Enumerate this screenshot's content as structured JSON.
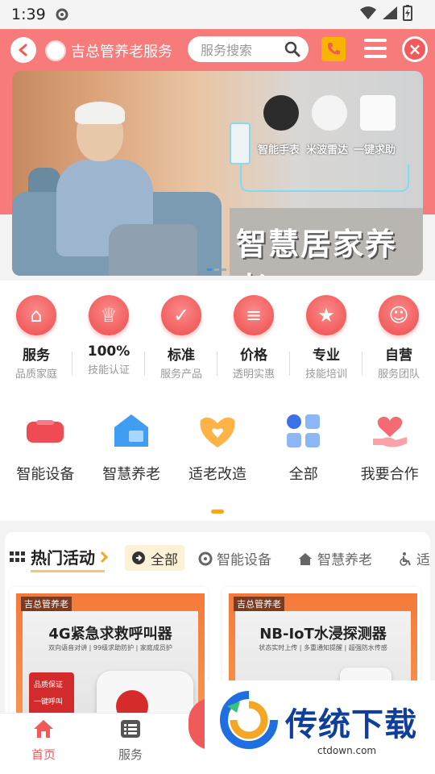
{
  "status_bar": {
    "time": "1:39"
  },
  "header": {
    "title": "吉总管养老服务",
    "search_placeholder": "服务搜索"
  },
  "banner": {
    "headline": "智慧居家养老",
    "devices": [
      "智能手表",
      "米波雷达",
      "一键求助"
    ],
    "active_slide": 1,
    "slide_count": 3
  },
  "features": [
    {
      "main": "服务",
      "sub": "品质家庭",
      "icon": "house-icon"
    },
    {
      "main": "100%",
      "sub": "技能认证",
      "icon": "crown-icon"
    },
    {
      "main": "标准",
      "sub": "服务产品",
      "icon": "clipboard-icon"
    },
    {
      "main": "价格",
      "sub": "透明实惠",
      "icon": "coins-icon"
    },
    {
      "main": "专业",
      "sub": "技能培训",
      "icon": "medal-icon"
    },
    {
      "main": "自营",
      "sub": "服务团队",
      "icon": "staff-icon"
    }
  ],
  "categories": [
    {
      "label": "智能设备",
      "icon": "device-icon"
    },
    {
      "label": "智慧养老",
      "icon": "smart-home-icon"
    },
    {
      "label": "适老改造",
      "icon": "heart-hands-icon"
    },
    {
      "label": "全部",
      "icon": "grid-icon"
    },
    {
      "label": "我要合作",
      "icon": "cooperation-icon"
    }
  ],
  "activities": {
    "title": "热门活动",
    "tabs": [
      "全部",
      "智能设备",
      "智慧养老",
      "适"
    ],
    "cards": [
      {
        "brand": "吉总管养老",
        "title": "4G紧急求救呼叫器",
        "subtitle": "双向语音对讲 | 99级求助防护 | 家庭成员护",
        "badges": [
          "品质保证",
          "一键呼叫"
        ]
      },
      {
        "brand": "吉总管养老",
        "title": "NB-IoT水浸探测器",
        "subtitle": "状态实时上传 | 多重通知提醒 | 超强防水传感",
        "badges": []
      }
    ]
  },
  "bottom_nav": [
    {
      "label": "首页",
      "icon": "home-icon",
      "active": true
    },
    {
      "label": "服务",
      "icon": "list-icon",
      "active": false
    }
  ],
  "watermark": {
    "text": "传统下载",
    "url": "ctdown.com"
  },
  "colors": {
    "brand": "#f05a5a",
    "accent": "#f5a623",
    "header_bg": "#f77b7b"
  }
}
